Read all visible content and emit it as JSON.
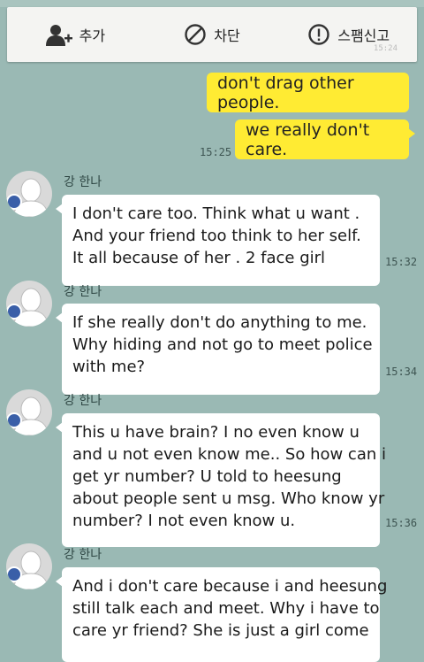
{
  "toolbar": {
    "add_label": "추가",
    "block_label": "차단",
    "spam_label": "스팸신고",
    "ghost_time": "15:24"
  },
  "sent_messages": [
    {
      "text": "don't drag other people."
    },
    {
      "text": "we really don't care.",
      "time": "15:25"
    }
  ],
  "received_messages": [
    {
      "sender": "강 한나",
      "lines": [
        "I don't care too. Think what u want .",
        "And your friend too think to her self.",
        "It all because of her . 2 face girl"
      ],
      "time": "15:32"
    },
    {
      "sender": "강 한나",
      "lines": [
        "If she really don't do anything to me.",
        "Why hiding and not go to meet police",
        "with me?"
      ],
      "time": "15:34"
    },
    {
      "sender": "강 한나",
      "lines": [
        "This u have brain? I no even know u",
        "and u not even know me.. So how can i",
        "get yr number? U told to heesung",
        "about people sent u msg. Who know yr",
        "number? I not even know u."
      ],
      "time": "15:36"
    },
    {
      "sender": "강 한나",
      "lines": [
        "And i don't care because i and heesung",
        "still talk each and meet. Why i have to",
        "care yr friend? She is just a girl come"
      ]
    }
  ],
  "colors": {
    "background": "#9ab9b4",
    "my_bubble": "#ffeb33",
    "their_bubble": "#ffffff"
  }
}
